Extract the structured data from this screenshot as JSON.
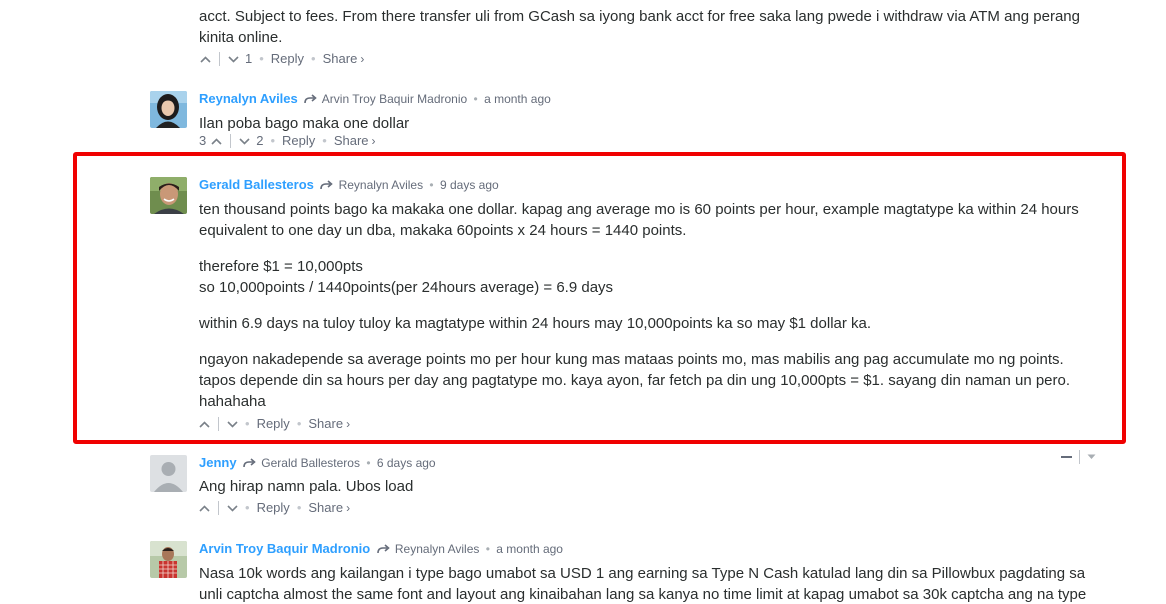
{
  "top_fragment": {
    "line1": "acct. Subject to fees. From there transfer uli from GCash sa iyong bank acct for free saka lang pwede i withdraw via ATM ang perang",
    "line2": "kinita online.",
    "footer": {
      "downvotes": "1",
      "reply": "Reply",
      "share": "Share"
    }
  },
  "comments": [
    {
      "author": "Reynalyn Aviles",
      "parent": "Arvin Troy Baquir Madronio",
      "time": "a month ago",
      "paragraphs": [
        "Ilan poba bago maka one dollar"
      ],
      "upvotes": "3",
      "downvotes": "2",
      "reply": "Reply",
      "share": "Share"
    },
    {
      "author": "Gerald Ballesteros",
      "parent": "Reynalyn Aviles",
      "time": "9 days ago",
      "paragraphs": [
        "ten thousand points bago ka makaka one dollar. kapag ang average mo is 60 points per hour, example magtatype ka within 24 hours equivalent to one day un dba, makaka 60points x 24 hours = 1440 points.",
        "therefore $1 = 10,000pts",
        "so 10,000points / 1440points(per 24hours average) = 6.9 days",
        "within 6.9 days na tuloy tuloy ka magtatype within 24 hours may 10,000points ka so may $1 dollar ka.",
        "ngayon nakadepende sa average points mo per hour kung mas mataas points mo, mas mabilis ang pag accumulate mo ng points. tapos depende din sa hours per day ang pagtatype mo. kaya ayon, far fetch pa din ung 10,000pts = $1. sayang din naman un pero. hahahaha"
      ],
      "reply": "Reply",
      "share": "Share"
    },
    {
      "author": "Jenny",
      "parent": "Gerald Ballesteros",
      "time": "6 days ago",
      "paragraphs": [
        "Ang hirap namn pala. Ubos load"
      ],
      "reply": "Reply",
      "share": "Share"
    },
    {
      "author": "Arvin Troy Baquir Madronio",
      "parent": "Reynalyn Aviles",
      "time": "a month ago",
      "paragraphs": [
        "Nasa 10k words ang kailangan i type bago umabot sa USD 1 ang earning sa Type N Cash katulad lang din sa Pillowbux pagdating sa unli captcha almost the same font and layout ang kinaibahan lang sa kanya no time limit at kapag umabot sa 30k captcha ang na type"
      ]
    }
  ],
  "colors": {
    "author": "#2e9fff",
    "highlight": "#f00000",
    "meta": "#656c7a",
    "text": "#2a2e2e"
  }
}
